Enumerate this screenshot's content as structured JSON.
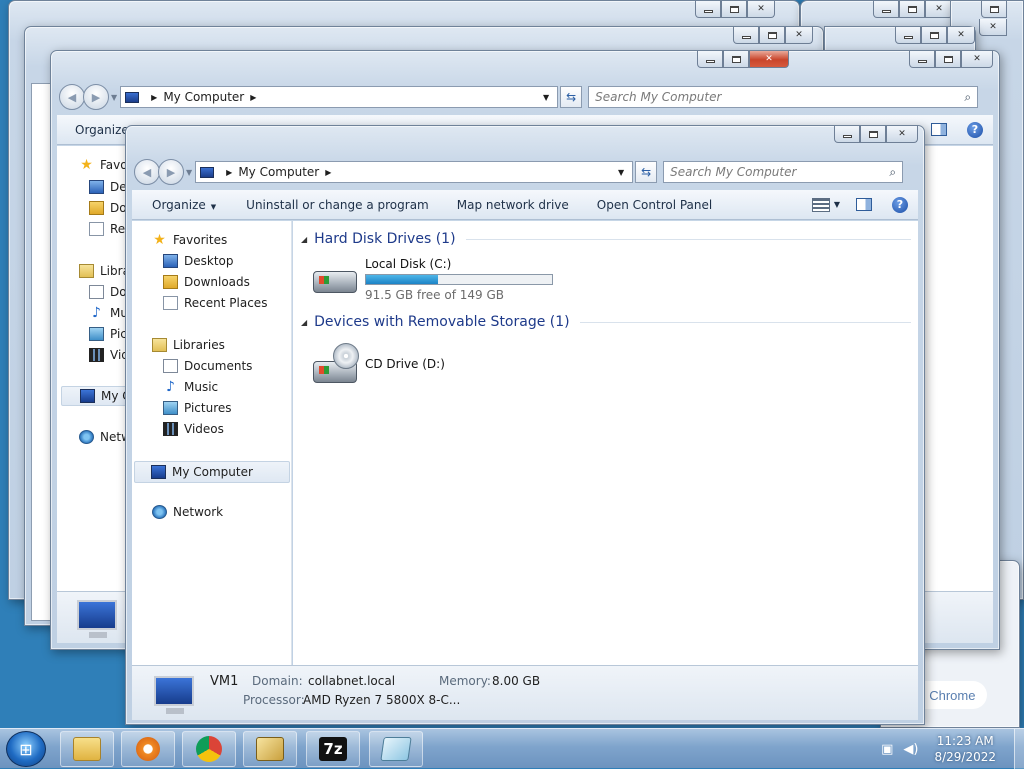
{
  "window": {
    "title": "My Computer",
    "search_placeholder": "Search My Computer",
    "address": "My Computer"
  },
  "commands": {
    "organize": "Organize",
    "uninstall": "Uninstall or change a program",
    "map_drive": "Map network drive",
    "control_panel": "Open Control Panel"
  },
  "nav": {
    "favorites": "Favorites",
    "desktop": "Desktop",
    "downloads": "Downloads",
    "recent": "Recent Places",
    "libraries": "Libraries",
    "documents": "Documents",
    "music": "Music",
    "pictures": "Pictures",
    "videos": "Videos",
    "my_computer": "My Computer",
    "network": "Network"
  },
  "back_nav": {
    "favorites": "Favo",
    "desktop": "Des",
    "downloads": "Dov",
    "recent": "Rec",
    "libraries": "Libra",
    "documents": "Do",
    "music": "Mu",
    "pictures": "Pic",
    "videos": "Vid",
    "my_computer": "My C",
    "network": "Netw",
    "organize": "Organize"
  },
  "groups": {
    "hdd": "Hard Disk Drives (1)",
    "removable": "Devices with Removable Storage (1)"
  },
  "drives": {
    "c_name": "Local Disk (C:)",
    "c_free": "91.5 GB free of 149 GB",
    "c_used_fraction": 0.386,
    "d_name": "CD Drive (D:)"
  },
  "details": {
    "computer_name": "VM1",
    "domain_label": "Domain:",
    "domain": "collabnet.local",
    "memory_label": "Memory:",
    "memory": "8.00 GB",
    "processor_label": "Processor:",
    "processor": "AMD Ryzen 7 5800X 8-C..."
  },
  "background_text": {
    "chrome_hint": "ize Chrome"
  },
  "taskbar": {
    "time": "11:23 AM",
    "date": "8/29/2022",
    "sevenzip_label": "7z"
  }
}
